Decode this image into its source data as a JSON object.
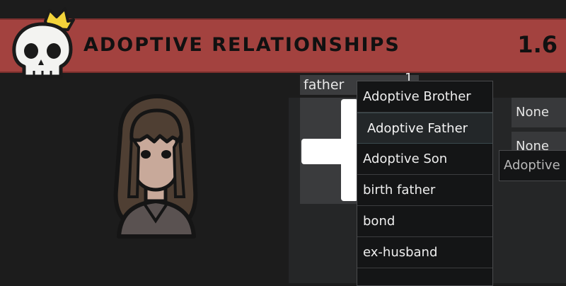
{
  "banner": {
    "title": "Adoptive Relationships",
    "version": "1.6",
    "background_color": "#a3423f"
  },
  "icons": {
    "logo": "crowned-skull-icon",
    "character": "character-portrait",
    "add": "plus-icon"
  },
  "relation_panel": {
    "selected_relation": "father",
    "count": "1"
  },
  "fields": {
    "field1": "None",
    "field2": "None"
  },
  "dropdown": {
    "items": [
      "Adoptive Brother",
      "Adoptive Father",
      "Adoptive Son",
      "birth father",
      "bond",
      "ex-husband"
    ],
    "highlighted_index": 1
  },
  "tooltip": {
    "text": "Adoptive"
  }
}
